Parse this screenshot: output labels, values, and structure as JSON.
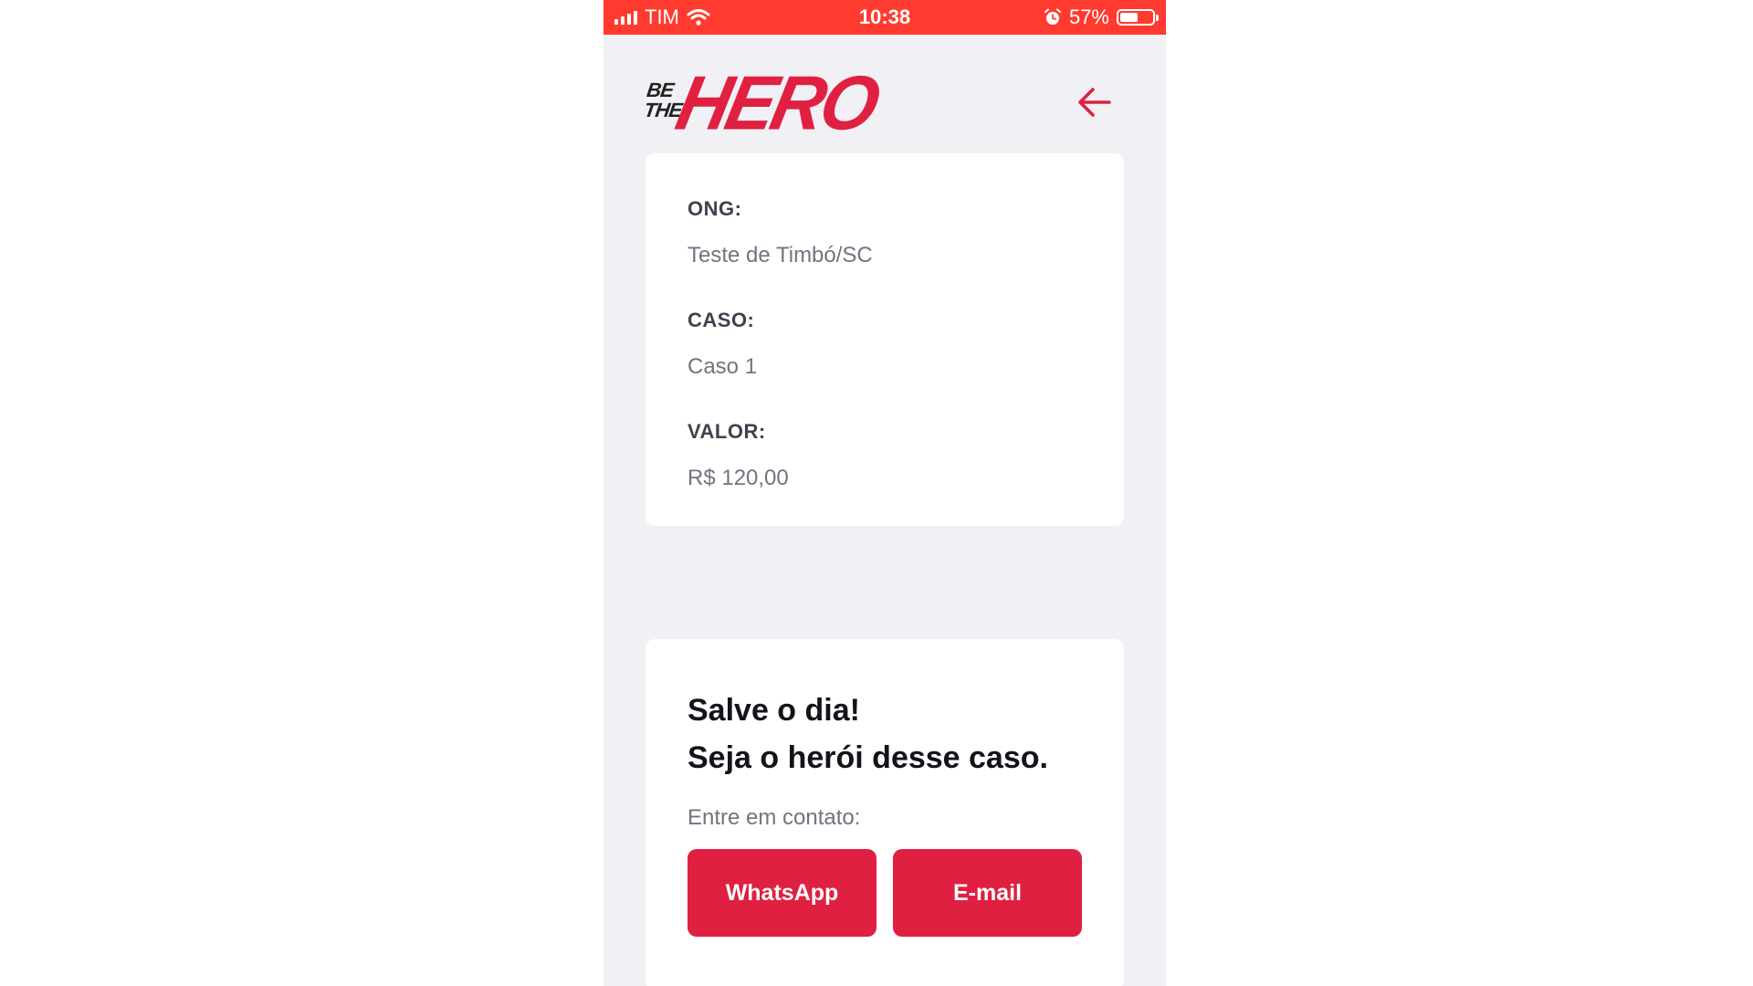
{
  "status_bar": {
    "carrier": "TIM",
    "time": "10:38",
    "battery_percent": "57%",
    "battery_level": 0.57,
    "icons": [
      "signal-icon",
      "wifi-icon",
      "alarm-icon",
      "battery-icon"
    ]
  },
  "header": {
    "logo_line1": "BE",
    "logo_line2": "THE",
    "logo_main": "HERO",
    "back_icon": "arrow-left-icon"
  },
  "incident": {
    "ong_label": "ONG:",
    "ong_value": "Teste de Timbó/SC",
    "case_label": "CASO:",
    "case_value": "Caso 1",
    "value_label": "VALOR:",
    "value_value": "R$ 120,00"
  },
  "contact": {
    "title_line1": "Salve o dia!",
    "title_line2": "Seja o herói desse caso.",
    "subtitle": "Entre em contato:",
    "whatsapp_label": "WhatsApp",
    "email_label": "E-mail"
  },
  "colors": {
    "accent": "#e02041",
    "status_bar": "#ff3b30",
    "background": "#f0f0f5",
    "card": "#ffffff"
  }
}
